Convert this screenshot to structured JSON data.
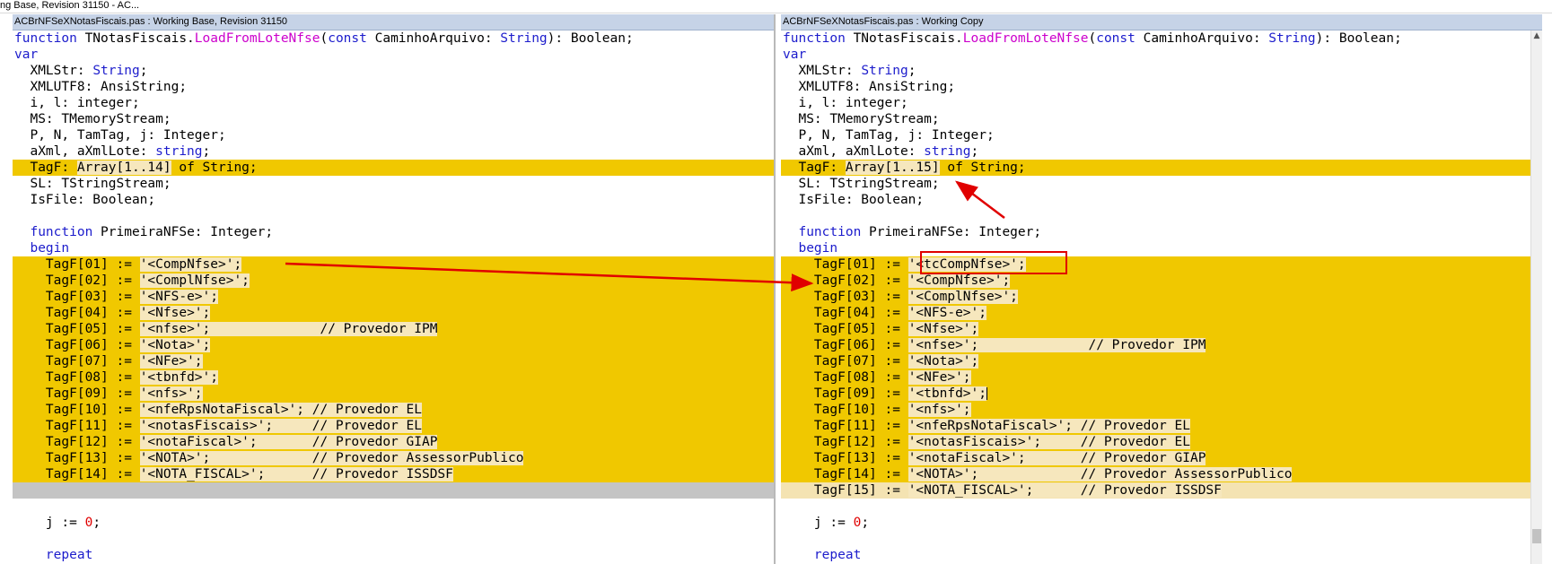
{
  "window": {
    "title": "ng Base, Revision 31150 - AC..."
  },
  "left_pane": {
    "header": "ACBrNFSeXNotasFiscais.pas : Working Base, Revision 31150",
    "lines": {
      "l1": [
        "function",
        " TNotasFiscais.",
        "LoadFromLoteNfse",
        "(",
        "const",
        " CaminhoArquivo: ",
        "String",
        "): Boolean;"
      ],
      "l2": "var",
      "l3": [
        "  XMLStr: ",
        "String",
        ";"
      ],
      "l4": "  XMLUTF8: AnsiString;",
      "l5": "  i, l: integer;",
      "l6": "  MS: TMemoryStream;",
      "l7": "  P, N, TamTag, j: Integer;",
      "l8": [
        "  aXml, aXmlLote: ",
        "string",
        ";"
      ],
      "l9": [
        "  TagF: ",
        "Array[1..14]",
        " of String;"
      ],
      "l10": "  SL: TStringStream;",
      "l11": "  IsFile: Boolean;",
      "l13": [
        "  ",
        "function",
        " PrimeiraNFSe: Integer;"
      ],
      "l14": "  begin",
      "tags": [
        [
          "    TagF[01] := ",
          "'<CompNfse>';",
          ""
        ],
        [
          "    TagF[02] := ",
          "'<ComplNfse>';",
          ""
        ],
        [
          "    TagF[03] := ",
          "'<NFS-e>';",
          ""
        ],
        [
          "    TagF[04] := ",
          "'<Nfse>';",
          ""
        ],
        [
          "    TagF[05] := ",
          "'<nfse>';",
          "              // Provedor IPM"
        ],
        [
          "    TagF[06] := ",
          "'<Nota>';",
          ""
        ],
        [
          "    TagF[07] := ",
          "'<NFe>';",
          ""
        ],
        [
          "    TagF[08] := ",
          "'<tbnfd>';",
          ""
        ],
        [
          "    TagF[09] := ",
          "'<nfs>';",
          ""
        ],
        [
          "    TagF[10] := ",
          "'<nfeRpsNotaFiscal>';",
          " // Provedor EL"
        ],
        [
          "    TagF[11] := ",
          "'<notasFiscais>';",
          "     // Provedor EL"
        ],
        [
          "    TagF[12] := ",
          "'<notaFiscal>';",
          "       // Provedor GIAP"
        ],
        [
          "    TagF[13] := ",
          "'<NOTA>';",
          "             // Provedor AssessorPublico"
        ],
        [
          "    TagF[14] := ",
          "'<NOTA_FISCAL>';",
          "      // Provedor ISSDSF"
        ]
      ],
      "j_line": [
        "    j := ",
        "0",
        ";"
      ],
      "repeat": "    repeat"
    }
  },
  "right_pane": {
    "header": "ACBrNFSeXNotasFiscais.pas : Working Copy",
    "lines": {
      "l1": [
        "function",
        " TNotasFiscais.",
        "LoadFromLoteNfse",
        "(",
        "const",
        " CaminhoArquivo: ",
        "String",
        "): Boolean;"
      ],
      "l2": "var",
      "l3": [
        "  XMLStr: ",
        "String",
        ";"
      ],
      "l4": "  XMLUTF8: AnsiString;",
      "l5": "  i, l: integer;",
      "l6": "  MS: TMemoryStream;",
      "l7": "  P, N, TamTag, j: Integer;",
      "l8": [
        "  aXml, aXmlLote: ",
        "string",
        ";"
      ],
      "l9": [
        "  TagF: ",
        "Array[1..15]",
        " of String;"
      ],
      "l10": "  SL: TStringStream;",
      "l11": "  IsFile: Boolean;",
      "l13": [
        "  ",
        "function",
        " PrimeiraNFSe: Integer;"
      ],
      "l14": "  begin",
      "tags": [
        [
          "    TagF[01] := ",
          "'<tcCompNfse>';",
          ""
        ],
        [
          "    TagF[02] := ",
          "'<CompNfse>';",
          ""
        ],
        [
          "    TagF[03] := ",
          "'<ComplNfse>';",
          ""
        ],
        [
          "    TagF[04] := ",
          "'<NFS-e>';",
          ""
        ],
        [
          "    TagF[05] := ",
          "'<Nfse>';",
          ""
        ],
        [
          "    TagF[06] := ",
          "'<nfse>';",
          "              // Provedor IPM"
        ],
        [
          "    TagF[07] := ",
          "'<Nota>';",
          ""
        ],
        [
          "    TagF[08] := ",
          "'<NFe>';",
          ""
        ],
        [
          "    TagF[09] := ",
          "'<tbnfd>';",
          ""
        ],
        [
          "    TagF[10] := ",
          "'<nfs>';",
          ""
        ],
        [
          "    TagF[11] := ",
          "'<nfeRpsNotaFiscal>';",
          " // Provedor EL"
        ],
        [
          "    TagF[12] := ",
          "'<notasFiscais>';",
          "     // Provedor EL"
        ],
        [
          "    TagF[13] := ",
          "'<notaFiscal>';",
          "       // Provedor GIAP"
        ],
        [
          "    TagF[14] := ",
          "'<NOTA>';",
          "             // Provedor AssessorPublico"
        ],
        [
          "    TagF[15] := ",
          "'<NOTA_FISCAL>';",
          "      // Provedor ISSDSF"
        ]
      ],
      "j_line": [
        "    j := ",
        "0",
        ";"
      ],
      "repeat": "    repeat"
    }
  },
  "colors": {
    "highlight": "#f0c800",
    "keyword": "#1c1ccc",
    "method": "#cc00cc",
    "number": "#e00000",
    "annotation": "#e00000"
  }
}
